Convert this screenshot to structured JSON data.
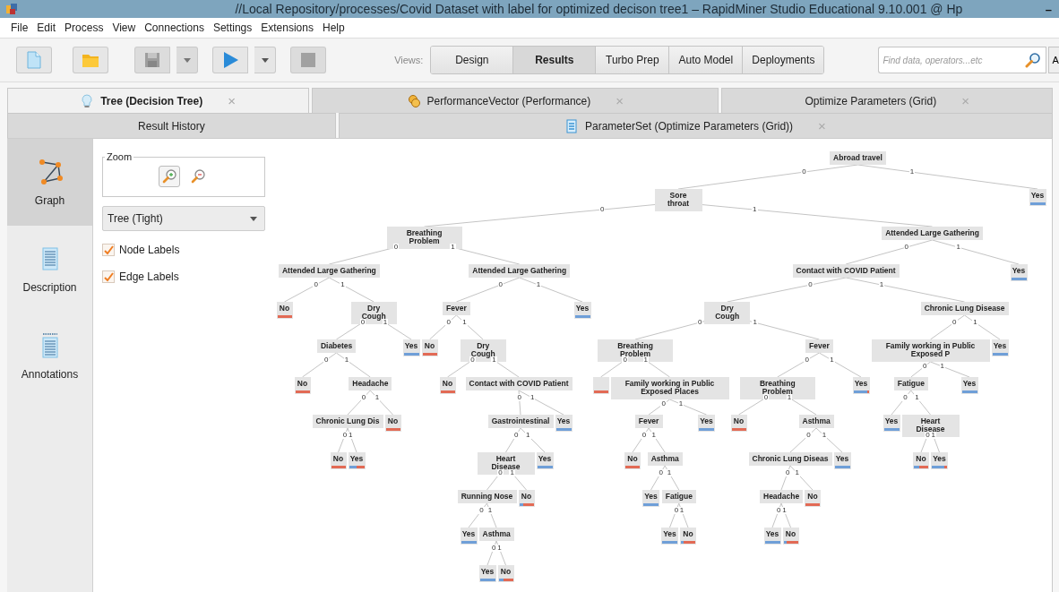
{
  "window": {
    "title": "//Local Repository/processes/Covid Dataset with label for optimized decison tree1 – RapidMiner Studio Educational 9.10.001 @ Hp",
    "minimize": "–"
  },
  "menu": [
    "File",
    "Edit",
    "Process",
    "View",
    "Connections",
    "Settings",
    "Extensions",
    "Help"
  ],
  "toolbar": {
    "buttons": [
      {
        "kind": "new",
        "disabled": false,
        "dropdown": false
      },
      {
        "kind": "open",
        "disabled": false,
        "dropdown": false
      },
      {
        "kind": "save",
        "disabled": true,
        "dropdown": true
      },
      {
        "kind": "run",
        "disabled": false,
        "dropdown": true
      },
      {
        "kind": "stop",
        "disabled": true,
        "dropdown": false
      }
    ],
    "views_label": "Views:",
    "views": [
      {
        "label": "Design",
        "selected": false
      },
      {
        "label": "Results",
        "selected": true
      },
      {
        "label": "Turbo Prep",
        "selected": false
      },
      {
        "label": "Auto Model",
        "selected": false
      },
      {
        "label": "Deployments",
        "selected": false
      }
    ],
    "search": {
      "placeholder": "Find data, operators...etc"
    },
    "edge_button": "A"
  },
  "tab_rows": [
    [
      {
        "label": "Tree (Decision Tree)",
        "kind": "tree",
        "selected": true,
        "close": "×"
      },
      {
        "label": "PerformanceVector (Performance)",
        "kind": "performance",
        "selected": false,
        "close": "×"
      },
      {
        "label": "Optimize Parameters (Grid)",
        "kind": "plain",
        "selected": false,
        "close": "×"
      }
    ],
    [
      {
        "label": "Result History",
        "kind": "plain",
        "selected": false
      },
      {
        "label": "ParameterSet (Optimize Parameters (Grid))",
        "kind": "parameters",
        "selected": false,
        "close": "×"
      }
    ]
  ],
  "side_nav": [
    {
      "label": "Graph",
      "kind": "graph",
      "selected": true
    },
    {
      "label": "Description",
      "kind": "description",
      "selected": false
    },
    {
      "label": "Annotations",
      "kind": "annotations",
      "selected": false
    }
  ],
  "graph_controls": {
    "zoom": {
      "label": "Zoom"
    },
    "layout": "Tree (Tight)",
    "options": [
      {
        "label": "Node Labels",
        "checked": true
      },
      {
        "label": "Edge Labels",
        "checked": true
      }
    ]
  },
  "tree": {
    "root": {
      "label": "Abroad travel",
      "children": [
        {
          "edge": "0",
          "label": "Sore throat",
          "children": [
            {
              "edge": "0",
              "label": "Breathing Problem",
              "children": [
                {
                  "edge": "0",
                  "label": "Attended Large Gathering",
                  "children": [
                    {
                      "edge": "0",
                      "label": "No",
                      "level": 0
                    },
                    {
                      "edge": "1",
                      "label": "Dry Cough",
                      "children": [
                        {
                          "edge": "0",
                          "label": "Diabetes",
                          "children": [
                            {
                              "edge": "0",
                              "label": "No",
                              "level": 0
                            },
                            {
                              "edge": "1",
                              "label": "Headache",
                              "children": [
                                {
                                  "edge": "0",
                                  "label": "Chronic Lung Dis",
                                  "children": [
                                    {
                                      "edge": "0",
                                      "label": "No",
                                      "level": 0
                                    },
                                    {
                                      "edge": "1",
                                      "label": "Yes",
                                      "level": 0.5
                                    }
                                  ]
                                },
                                {
                                  "edge": "1",
                                  "label": "No",
                                  "level": 0
                                }
                              ]
                            }
                          ]
                        },
                        {
                          "edge": "1",
                          "label": "Yes",
                          "level": 1
                        }
                      ]
                    }
                  ]
                },
                {
                  "edge": "1",
                  "label": "Attended Large Gathering",
                  "children": [
                    {
                      "edge": "0",
                      "label": "Fever",
                      "children": [
                        {
                          "edge": "0",
                          "label": "No",
                          "level": 0
                        },
                        {
                          "edge": "1",
                          "label": "Dry Cough",
                          "children": [
                            {
                              "edge": "0",
                              "label": "No",
                              "level": 0
                            },
                            {
                              "edge": "1",
                              "label": "Contact with COVID Patient",
                              "children": [
                                {
                                  "edge": "0",
                                  "label": "Gastrointestinal",
                                  "children": [
                                    {
                                      "edge": "0",
                                      "label": "Heart Disease",
                                      "children": [
                                        {
                                          "edge": "0",
                                          "label": "Running Nose",
                                          "children": [
                                            {
                                              "edge": "0",
                                              "label": "Yes",
                                              "level": 1
                                            },
                                            {
                                              "edge": "1",
                                              "label": "Asthma",
                                              "children": [
                                                {
                                                  "edge": "0",
                                                  "label": "Yes",
                                                  "level": 1
                                                },
                                                {
                                                  "edge": "1",
                                                  "label": "No",
                                                  "level": 0.35
                                                }
                                              ]
                                            }
                                          ]
                                        },
                                        {
                                          "edge": "1",
                                          "label": "No",
                                          "level": 0.3
                                        }
                                      ]
                                    },
                                    {
                                      "edge": "1",
                                      "label": "Yes",
                                      "level": 1
                                    }
                                  ]
                                },
                                {
                                  "edge": "1",
                                  "label": "Yes",
                                  "level": 1
                                }
                              ]
                            }
                          ]
                        }
                      ]
                    },
                    {
                      "edge": "1",
                      "label": "Yes",
                      "level": 1
                    }
                  ]
                }
              ]
            },
            {
              "edge": "1",
              "label": "Attended Large Gathering",
              "children": [
                {
                  "edge": "0",
                  "label": "Contact with COVID Patient",
                  "children": [
                    {
                      "edge": "0",
                      "label": "Dry Cough",
                      "children": [
                        {
                          "edge": "0",
                          "label": "Breathing Problem",
                          "children": [
                            {
                              "edge": "0",
                              "level": 0
                            },
                            {
                              "edge": "1",
                              "label": "Family working in Public Exposed Places",
                              "children": [
                                {
                                  "edge": "0",
                                  "label": "Fever",
                                  "children": [
                                    {
                                      "edge": "0",
                                      "label": "No",
                                      "level": 0
                                    },
                                    {
                                      "edge": "1",
                                      "label": "Asthma",
                                      "children": [
                                        {
                                          "edge": "0",
                                          "label": "Yes",
                                          "level": 1
                                        },
                                        {
                                          "edge": "1",
                                          "label": "Fatigue",
                                          "children": [
                                            {
                                              "edge": "0",
                                              "label": "Yes",
                                              "level": 1
                                            },
                                            {
                                              "edge": "1",
                                              "label": "No",
                                              "level": 0.2
                                            }
                                          ]
                                        }
                                      ]
                                    }
                                  ]
                                },
                                {
                                  "edge": "1",
                                  "label": "Yes",
                                  "level": 1
                                }
                              ]
                            }
                          ]
                        },
                        {
                          "edge": "1",
                          "label": "Fever",
                          "children": [
                            {
                              "edge": "0",
                              "label": "Breathing Problem",
                              "children": [
                                {
                                  "edge": "0",
                                  "label": "No",
                                  "level": 0
                                },
                                {
                                  "edge": "1",
                                  "label": "Asthma",
                                  "children": [
                                    {
                                      "edge": "0",
                                      "label": "Chronic Lung Diseas",
                                      "children": [
                                        {
                                          "edge": "0",
                                          "label": "Headache",
                                          "children": [
                                            {
                                              "edge": "0",
                                              "label": "Yes",
                                              "level": 1
                                            },
                                            {
                                              "edge": "1",
                                              "label": "No",
                                              "level": 0.2
                                            }
                                          ]
                                        },
                                        {
                                          "edge": "1",
                                          "label": "No",
                                          "level": 0
                                        }
                                      ]
                                    },
                                    {
                                      "edge": "1",
                                      "label": "Yes",
                                      "level": 1
                                    }
                                  ]
                                }
                              ]
                            },
                            {
                              "edge": "1",
                              "label": "Yes",
                              "level": 0.9
                            }
                          ]
                        }
                      ]
                    },
                    {
                      "edge": "1",
                      "label": "Chronic Lung Disease",
                      "children": [
                        {
                          "edge": "0",
                          "label": "Family working in Public Exposed P",
                          "children": [
                            {
                              "edge": "0",
                              "label": "Fatigue",
                              "children": [
                                {
                                  "edge": "0",
                                  "label": "Yes",
                                  "level": 1
                                },
                                {
                                  "edge": "1",
                                  "label": "Heart Disease",
                                  "children": [
                                    {
                                      "edge": "0",
                                      "label": "No",
                                      "level": 0.4
                                    },
                                    {
                                      "edge": "1",
                                      "label": "Yes",
                                      "level": 0.8
                                    }
                                  ]
                                }
                              ]
                            },
                            {
                              "edge": "1",
                              "label": "Yes",
                              "level": 1
                            }
                          ]
                        },
                        {
                          "edge": "1",
                          "label": "Yes",
                          "level": 1
                        }
                      ]
                    }
                  ]
                },
                {
                  "edge": "1",
                  "label": "Yes",
                  "level": 1
                }
              ]
            }
          ]
        },
        {
          "edge": "1",
          "label": "Yes",
          "level": 1
        }
      ]
    }
  }
}
